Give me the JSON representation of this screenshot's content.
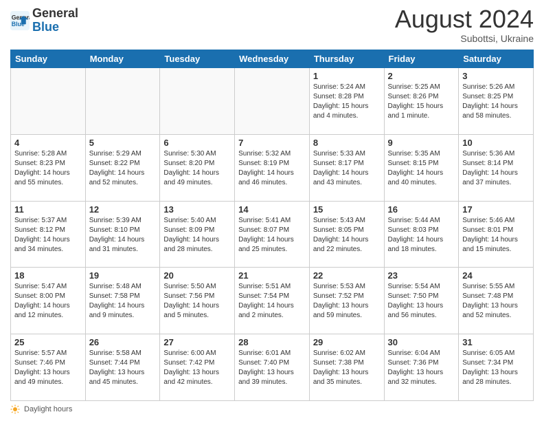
{
  "header": {
    "logo_line1": "General",
    "logo_line2": "Blue",
    "month_year": "August 2024",
    "location": "Subottsi, Ukraine"
  },
  "weekdays": [
    "Sunday",
    "Monday",
    "Tuesday",
    "Wednesday",
    "Thursday",
    "Friday",
    "Saturday"
  ],
  "footer": {
    "daylight_label": "Daylight hours"
  },
  "weeks": [
    [
      {
        "day": "",
        "info": ""
      },
      {
        "day": "",
        "info": ""
      },
      {
        "day": "",
        "info": ""
      },
      {
        "day": "",
        "info": ""
      },
      {
        "day": "1",
        "info": "Sunrise: 5:24 AM\nSunset: 8:28 PM\nDaylight: 15 hours\nand 4 minutes."
      },
      {
        "day": "2",
        "info": "Sunrise: 5:25 AM\nSunset: 8:26 PM\nDaylight: 15 hours\nand 1 minute."
      },
      {
        "day": "3",
        "info": "Sunrise: 5:26 AM\nSunset: 8:25 PM\nDaylight: 14 hours\nand 58 minutes."
      }
    ],
    [
      {
        "day": "4",
        "info": "Sunrise: 5:28 AM\nSunset: 8:23 PM\nDaylight: 14 hours\nand 55 minutes."
      },
      {
        "day": "5",
        "info": "Sunrise: 5:29 AM\nSunset: 8:22 PM\nDaylight: 14 hours\nand 52 minutes."
      },
      {
        "day": "6",
        "info": "Sunrise: 5:30 AM\nSunset: 8:20 PM\nDaylight: 14 hours\nand 49 minutes."
      },
      {
        "day": "7",
        "info": "Sunrise: 5:32 AM\nSunset: 8:19 PM\nDaylight: 14 hours\nand 46 minutes."
      },
      {
        "day": "8",
        "info": "Sunrise: 5:33 AM\nSunset: 8:17 PM\nDaylight: 14 hours\nand 43 minutes."
      },
      {
        "day": "9",
        "info": "Sunrise: 5:35 AM\nSunset: 8:15 PM\nDaylight: 14 hours\nand 40 minutes."
      },
      {
        "day": "10",
        "info": "Sunrise: 5:36 AM\nSunset: 8:14 PM\nDaylight: 14 hours\nand 37 minutes."
      }
    ],
    [
      {
        "day": "11",
        "info": "Sunrise: 5:37 AM\nSunset: 8:12 PM\nDaylight: 14 hours\nand 34 minutes."
      },
      {
        "day": "12",
        "info": "Sunrise: 5:39 AM\nSunset: 8:10 PM\nDaylight: 14 hours\nand 31 minutes."
      },
      {
        "day": "13",
        "info": "Sunrise: 5:40 AM\nSunset: 8:09 PM\nDaylight: 14 hours\nand 28 minutes."
      },
      {
        "day": "14",
        "info": "Sunrise: 5:41 AM\nSunset: 8:07 PM\nDaylight: 14 hours\nand 25 minutes."
      },
      {
        "day": "15",
        "info": "Sunrise: 5:43 AM\nSunset: 8:05 PM\nDaylight: 14 hours\nand 22 minutes."
      },
      {
        "day": "16",
        "info": "Sunrise: 5:44 AM\nSunset: 8:03 PM\nDaylight: 14 hours\nand 18 minutes."
      },
      {
        "day": "17",
        "info": "Sunrise: 5:46 AM\nSunset: 8:01 PM\nDaylight: 14 hours\nand 15 minutes."
      }
    ],
    [
      {
        "day": "18",
        "info": "Sunrise: 5:47 AM\nSunset: 8:00 PM\nDaylight: 14 hours\nand 12 minutes."
      },
      {
        "day": "19",
        "info": "Sunrise: 5:48 AM\nSunset: 7:58 PM\nDaylight: 14 hours\nand 9 minutes."
      },
      {
        "day": "20",
        "info": "Sunrise: 5:50 AM\nSunset: 7:56 PM\nDaylight: 14 hours\nand 5 minutes."
      },
      {
        "day": "21",
        "info": "Sunrise: 5:51 AM\nSunset: 7:54 PM\nDaylight: 14 hours\nand 2 minutes."
      },
      {
        "day": "22",
        "info": "Sunrise: 5:53 AM\nSunset: 7:52 PM\nDaylight: 13 hours\nand 59 minutes."
      },
      {
        "day": "23",
        "info": "Sunrise: 5:54 AM\nSunset: 7:50 PM\nDaylight: 13 hours\nand 56 minutes."
      },
      {
        "day": "24",
        "info": "Sunrise: 5:55 AM\nSunset: 7:48 PM\nDaylight: 13 hours\nand 52 minutes."
      }
    ],
    [
      {
        "day": "25",
        "info": "Sunrise: 5:57 AM\nSunset: 7:46 PM\nDaylight: 13 hours\nand 49 minutes."
      },
      {
        "day": "26",
        "info": "Sunrise: 5:58 AM\nSunset: 7:44 PM\nDaylight: 13 hours\nand 45 minutes."
      },
      {
        "day": "27",
        "info": "Sunrise: 6:00 AM\nSunset: 7:42 PM\nDaylight: 13 hours\nand 42 minutes."
      },
      {
        "day": "28",
        "info": "Sunrise: 6:01 AM\nSunset: 7:40 PM\nDaylight: 13 hours\nand 39 minutes."
      },
      {
        "day": "29",
        "info": "Sunrise: 6:02 AM\nSunset: 7:38 PM\nDaylight: 13 hours\nand 35 minutes."
      },
      {
        "day": "30",
        "info": "Sunrise: 6:04 AM\nSunset: 7:36 PM\nDaylight: 13 hours\nand 32 minutes."
      },
      {
        "day": "31",
        "info": "Sunrise: 6:05 AM\nSunset: 7:34 PM\nDaylight: 13 hours\nand 28 minutes."
      }
    ]
  ]
}
